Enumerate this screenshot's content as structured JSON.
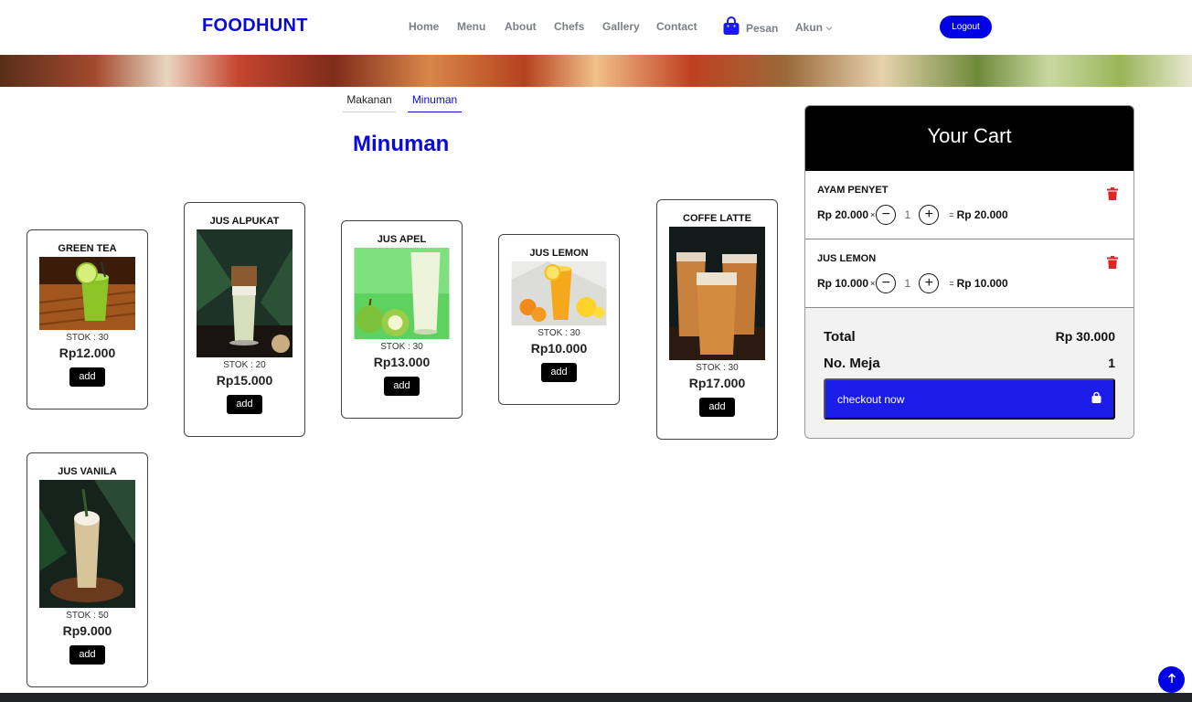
{
  "nav": {
    "brand": "FOODHUNT",
    "links": [
      "Home",
      "Menu",
      "About",
      "Chefs",
      "Gallery",
      "Contact"
    ],
    "pesan": "Pesan",
    "akun": "Akun",
    "logout": "Logout"
  },
  "tabs": [
    "Makanan",
    "Minuman"
  ],
  "active_tab": "Minuman",
  "section_title": "Minuman",
  "products": [
    {
      "name": "GREEN TEA",
      "stock": "STOK : 30",
      "price": "Rp12.000",
      "add": "add"
    },
    {
      "name": "JUS ALPUKAT",
      "stock": "STOK : 20",
      "price": "Rp15.000",
      "add": "add"
    },
    {
      "name": "JUS APEL",
      "stock": "STOK : 30",
      "price": "Rp13.000",
      "add": "add"
    },
    {
      "name": "JUS LEMON",
      "stock": "STOK : 30",
      "price": "Rp10.000",
      "add": "add"
    },
    {
      "name": "COFFE LATTE",
      "stock": "STOK : 30",
      "price": "Rp17.000",
      "add": "add"
    },
    {
      "name": "JUS VANILA",
      "stock": "STOK : 50",
      "price": "Rp9.000",
      "add": "add"
    }
  ],
  "cart": {
    "title": "Your Cart",
    "items": [
      {
        "name": "AYAM PENYET",
        "price": "Rp 20.000",
        "times": "×",
        "qty": "1",
        "equals": "=",
        "subtotal": "Rp 20.000"
      },
      {
        "name": "JUS LEMON",
        "price": "Rp 10.000",
        "times": "×",
        "qty": "1",
        "equals": "=",
        "subtotal": "Rp 10.000"
      }
    ],
    "total_label": "Total",
    "total_value": "Rp 30.000",
    "meja_label": "No. Meja",
    "meja_value": "1",
    "checkout": "checkout now"
  },
  "colors": {
    "brand": "#0a0ad6",
    "button": "#1c1ce8",
    "danger": "#e02424"
  }
}
